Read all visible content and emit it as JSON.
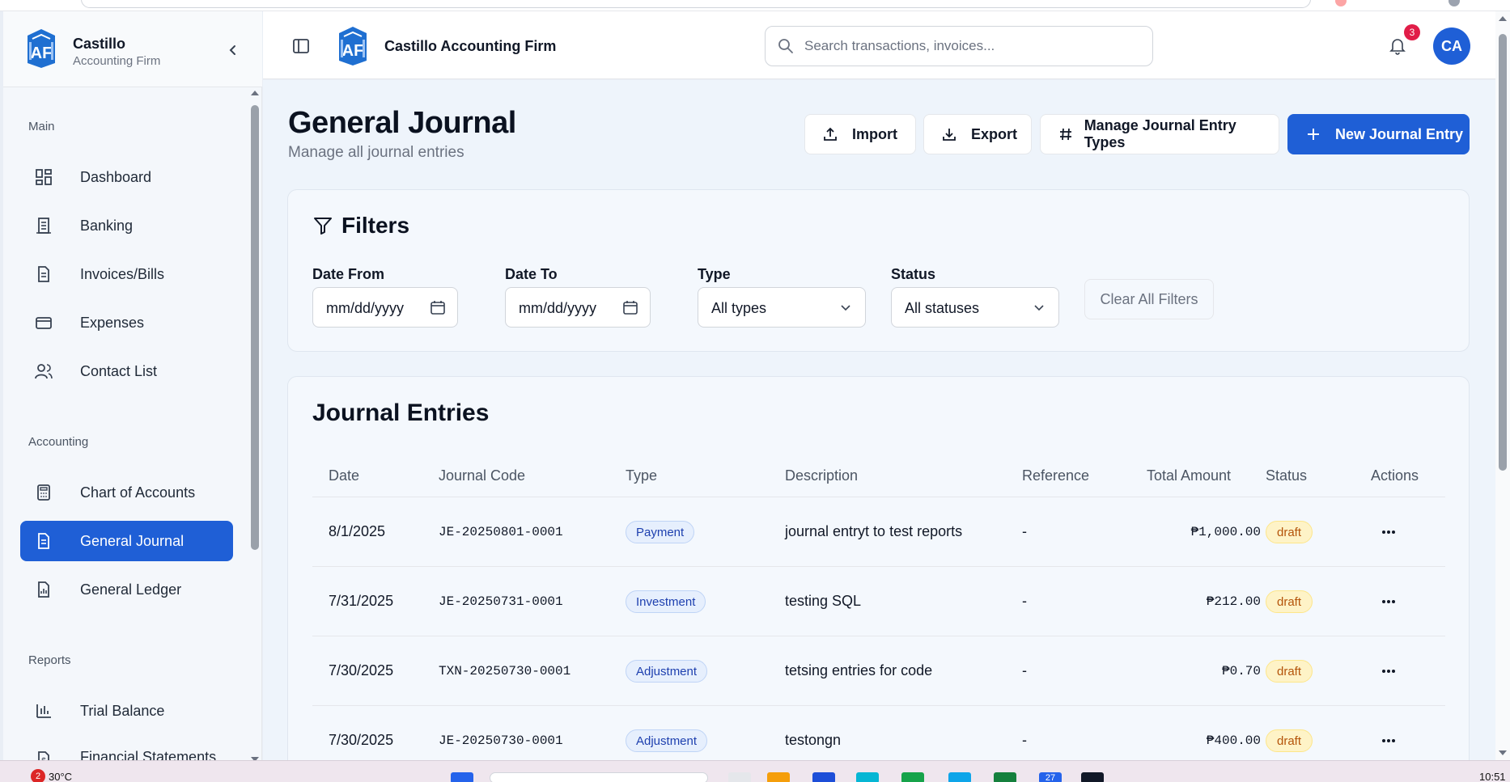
{
  "brand": {
    "name": "Castillo",
    "subtitle": "Accounting Firm",
    "full_name": "Castillo Accounting Firm",
    "colors": {
      "primary": "#1f5fd6",
      "logo_blue": "#1f6fd1"
    }
  },
  "sidebar": {
    "sections": [
      {
        "label": "Main",
        "items": [
          {
            "label": "Dashboard",
            "icon": "dashboard-icon"
          },
          {
            "label": "Banking",
            "icon": "banking-icon"
          },
          {
            "label": "Invoices/Bills",
            "icon": "invoice-icon"
          },
          {
            "label": "Expenses",
            "icon": "credit-card-icon"
          },
          {
            "label": "Contact List",
            "icon": "users-icon"
          }
        ]
      },
      {
        "label": "Accounting",
        "items": [
          {
            "label": "Chart of Accounts",
            "icon": "calculator-icon"
          },
          {
            "label": "General Journal",
            "icon": "journal-icon",
            "active": true
          },
          {
            "label": "General Ledger",
            "icon": "ledger-icon"
          }
        ]
      },
      {
        "label": "Reports",
        "items": [
          {
            "label": "Trial Balance",
            "icon": "bar-chart-icon"
          },
          {
            "label": "Financial Statements",
            "icon": "statement-icon"
          }
        ]
      }
    ]
  },
  "header": {
    "title": "Castillo Accounting Firm",
    "search_placeholder": "Search transactions, invoices...",
    "notification_count": "3",
    "avatar_initials": "CA"
  },
  "page": {
    "title": "General Journal",
    "subtitle": "Manage all journal entries",
    "buttons": {
      "import": "Import",
      "export": "Export",
      "manage_types": "Manage Journal Entry Types",
      "new_entry": "New Journal Entry"
    }
  },
  "filters": {
    "title": "Filters",
    "date_from_label": "Date From",
    "date_from_value": "mm/dd/yyyy",
    "date_to_label": "Date To",
    "date_to_value": "mm/dd/yyyy",
    "type_label": "Type",
    "type_value": "All types",
    "status_label": "Status",
    "status_value": "All statuses",
    "clear_label": "Clear All Filters"
  },
  "journal": {
    "title": "Journal Entries",
    "columns": [
      "Date",
      "Journal Code",
      "Type",
      "Description",
      "Reference",
      "Total Amount",
      "Status",
      "Actions"
    ],
    "rows": [
      {
        "date": "8/1/2025",
        "code": "JE-20250801-0001",
        "type": "Payment",
        "description": "journal entryt to test reports",
        "reference": "-",
        "amount": "₱1,000.00",
        "status": "draft"
      },
      {
        "date": "7/31/2025",
        "code": "JE-20250731-0001",
        "type": "Investment",
        "description": "testing SQL",
        "reference": "-",
        "amount": "₱212.00",
        "status": "draft"
      },
      {
        "date": "7/30/2025",
        "code": "TXN-20250730-0001",
        "type": "Adjustment",
        "description": "tetsing entries for code",
        "reference": "-",
        "amount": "₱0.70",
        "status": "draft"
      },
      {
        "date": "7/30/2025",
        "code": "JE-20250730-0001",
        "type": "Adjustment",
        "description": "testongn",
        "reference": "-",
        "amount": "₱400.00",
        "status": "draft"
      }
    ]
  },
  "taskbar": {
    "weather": "30°C",
    "weather_badge": "2",
    "time": "10:51",
    "app_badge": "27"
  }
}
